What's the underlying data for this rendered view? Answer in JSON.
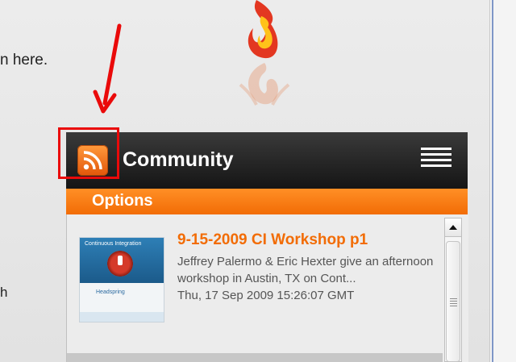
{
  "background": {
    "line1": "n here.",
    "line2": "h"
  },
  "widget": {
    "title": "Community",
    "options_label": "Options",
    "header_icon": "rss-icon",
    "menu_icon": "hamburger-menu-icon",
    "feed": [
      {
        "title": "9-15-2009 CI Workshop p1",
        "description": "Jeffrey Palermo & Eric Hexter give an afternoon workshop in Austin, TX on Cont...",
        "date": "Thu, 17 Sep 2009 15:26:07 GMT",
        "thumb_title": "Continuous Integration",
        "thumb_subtitle": "Headspring"
      }
    ]
  },
  "colors": {
    "accent_orange": "#f26c05",
    "header_dark": "#1e1e1e",
    "annotation_red": "#ea0a0a"
  }
}
